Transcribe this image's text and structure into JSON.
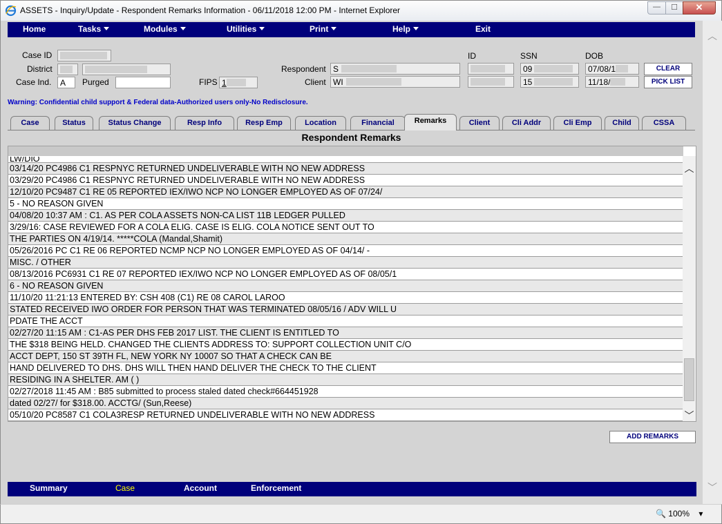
{
  "window": {
    "title": "ASSETS - Inquiry/Update - Respondent Remarks Information -   06/11/2018 12:00 PM - Internet Explorer",
    "minimize_glyph": "—",
    "maximize_glyph": "☐",
    "close_glyph": "✕"
  },
  "topnav": {
    "home": "Home",
    "tasks": "Tasks",
    "modules": "Modules",
    "utilities": "Utilities",
    "print": "Print",
    "help": "Help",
    "exit": "Exit"
  },
  "header": {
    "case_id_label": "Case ID",
    "district_label": "District",
    "case_ind_label": "Case Ind.",
    "case_ind_value": "A",
    "purged_label": "Purged",
    "fips_label": "FIPS",
    "fips_value": "1",
    "respondent_label": "Respondent",
    "respondent_value": "S",
    "client_label": "Client",
    "client_value": "WI",
    "id_label": "ID",
    "ssn_label": "SSN",
    "ssn_respondent": "09",
    "ssn_client": "15",
    "dob_label": "DOB",
    "dob_respondent": "07/08/1",
    "dob_client": "11/18/",
    "clear_button": "CLEAR",
    "pick_list_button": "PICK LIST"
  },
  "warning": "Warning: Confidential child support & Federal data-Authorized users only-No Redisclosure.",
  "tabs": [
    "Case",
    "Status",
    "Status Change",
    "Resp Info",
    "Resp Emp",
    "Location",
    "Financial",
    "Remarks",
    "Client",
    "Cli Addr",
    "Cli Emp",
    "Child",
    "CSSA"
  ],
  "active_tab": "Remarks",
  "section_title": "Respondent Remarks",
  "remarks": [
    "LW/DIO",
    "03/14/20    PC4986 C1 RESPNYC RETURNED UNDELIVERABLE WITH NO NEW ADDRESS",
    "03/29/20    PC4986 C1 RESPNYC RETURNED UNDELIVERABLE WITH NO NEW ADDRESS",
    "12/10/20    PC9487 C1 RE 05 REPORTED IEX/IWO NCP NO LONGER EMPLOYED AS OF 07/24/",
    "5 - NO REASON GIVEN",
    "04/08/20    10:37 AM : C1. AS PER COLA ASSETS NON-CA LIST 11B LEDGER PULLED",
    "3/29/16: CASE REVIEWED FOR A COLA ELIG. CASE IS ELIG. COLA NOTICE SENT OUT TO",
    "THE PARTIES ON 4/19/14. *****COLA (Mandal,Shamit)",
    "05/26/2016 PC       C1 RE 06 REPORTED NCMP NCP NO LONGER EMPLOYED AS OF 04/14/     -",
    "MISC. / OTHER",
    "08/13/2016 PC6931 C1 RE 07 REPORTED IEX/IWO NCP NO LONGER EMPLOYED AS OF 08/05/1",
    "6 - NO REASON GIVEN",
    "11/10/20    11:21:13 ENTERED BY: CSH 408         (C1) RE 08 CAROL LAROO",
    "STATED RECEIVED IWO ORDER FOR PERSON THAT WAS TERMINATED 08/05/16 / ADV WILL U",
    "PDATE THE ACCT",
    "02/27/20    11:15 AM : C1-AS PER DHS FEB 2017 LIST. THE CLIENT IS ENTITLED TO",
    "THE $318 BEING HELD. CHANGED THE CLIENTS ADDRESS TO: SUPPORT COLLECTION UNIT C/O",
    "ACCT DEPT, 150                    ST 39TH FL, NEW YORK NY 10007 SO THAT A CHECK CAN BE",
    "HAND DELIVERED TO DHS. DHS WILL THEN HAND DELIVER THE CHECK TO THE CLIENT",
    "RESIDING IN A SHELTER. AM (                        )",
    "02/27/2018 11:45 AM : B85 submitted to process staled dated check#664451928",
    "dated 02/27/      for $318.00. ACCTG/ (Sun,Reese)",
    "05/10/20    PC8587 C1 COLA3RESP RETURNED UNDELIVERABLE WITH NO NEW ADDRESS"
  ],
  "add_remarks_button": "ADD REMARKS",
  "bottomnav": {
    "summary": "Summary",
    "case": "Case",
    "account": "Account",
    "enforcement": "Enforcement"
  },
  "statusbar": {
    "zoom": "100%"
  }
}
